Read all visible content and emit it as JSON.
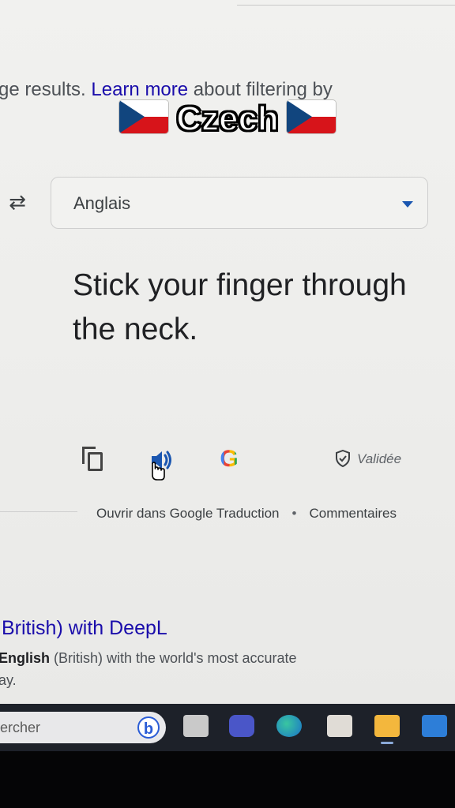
{
  "header": {
    "filter_text_before": "ge results. ",
    "filter_link": "Learn more",
    "filter_text_after": " about filtering by"
  },
  "overlay": {
    "caption": "Czech",
    "flag_icon": "czech-flag-icon"
  },
  "translator": {
    "swap_icon": "⇄",
    "target_language": "Anglais",
    "translation_text": "Stick your finger through the neck.",
    "verified_label": "Validée",
    "open_link": "Ouvrir dans Google Traduction",
    "separator": "•",
    "feedback_link": "Commentaires",
    "google_letter": "G"
  },
  "result": {
    "title": "British) with DeepL",
    "snippet_bold": "English",
    "snippet_rest": " (British) with the world's most accurate",
    "snippet_line2": "ay."
  },
  "taskbar": {
    "search_text": "ercher",
    "bing_letter": "b"
  },
  "colors": {
    "link_blue": "#1a0dab",
    "accent_blue": "#1a56b0",
    "czech_red": "#d7141a",
    "czech_blue": "#11457e"
  }
}
